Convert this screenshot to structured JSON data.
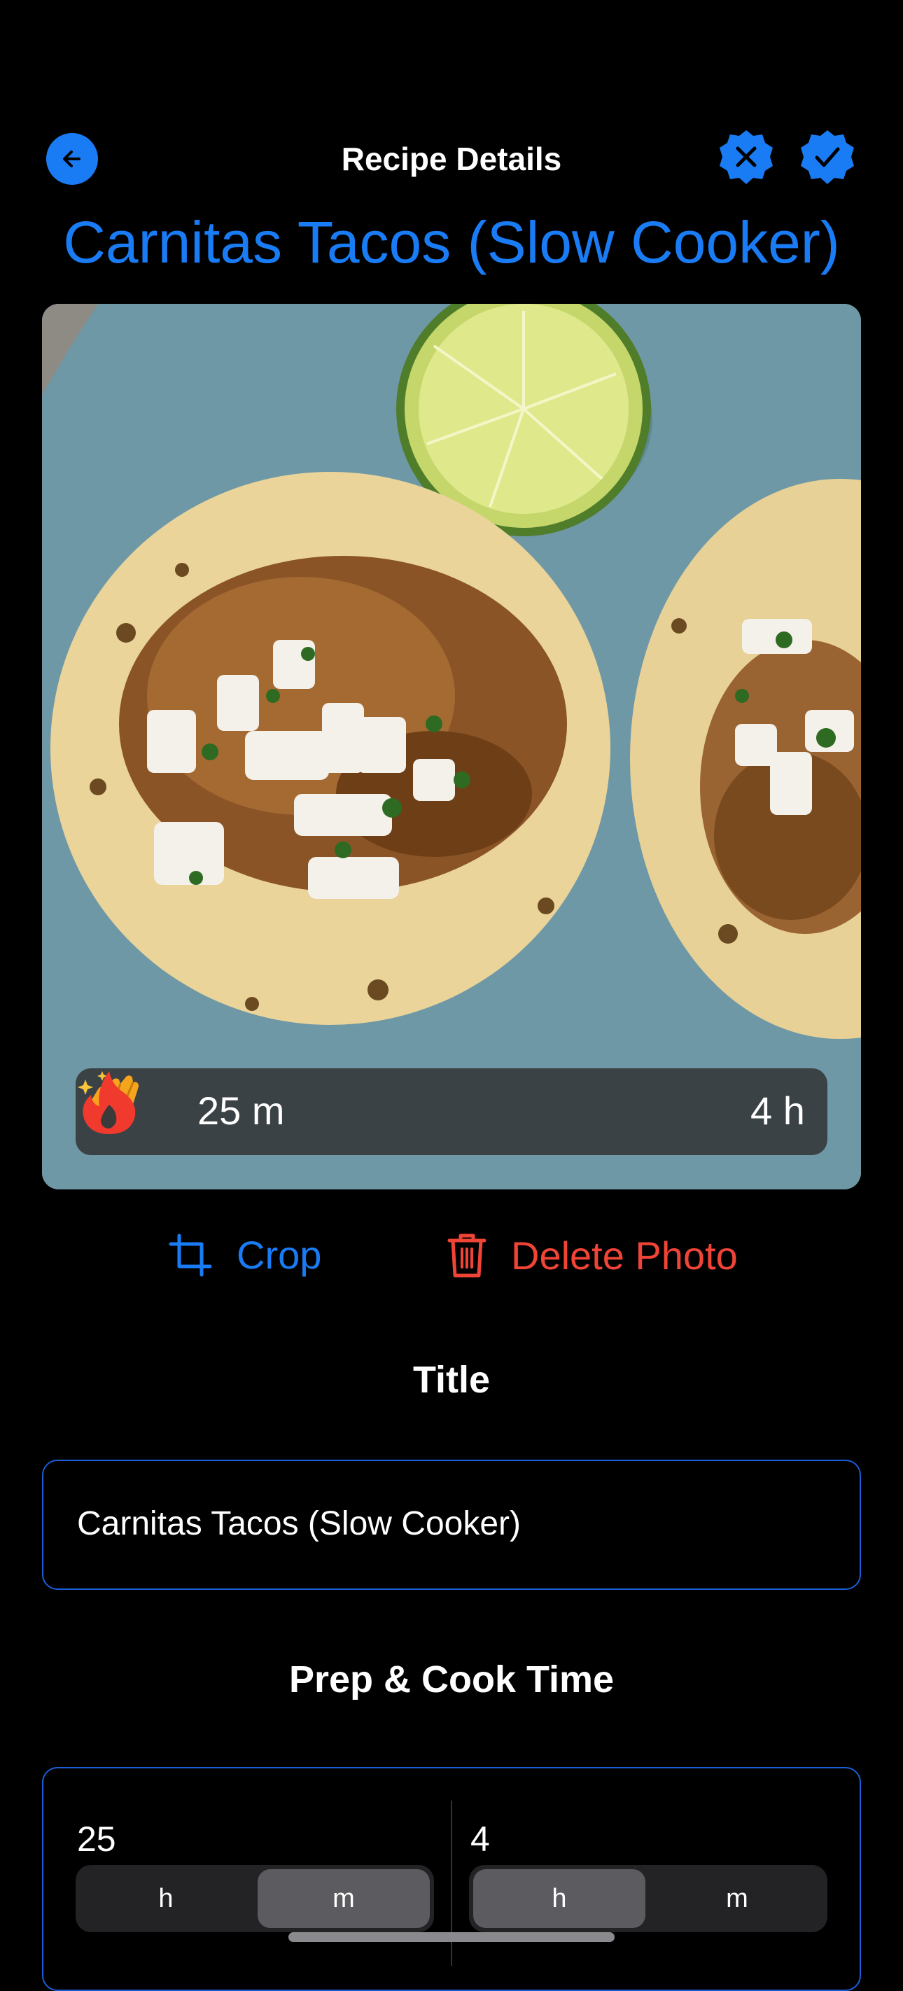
{
  "nav": {
    "title": "Recipe Details"
  },
  "recipe_title": "Carnitas Tacos (Slow Cooker)",
  "photo": {
    "prep_time": "25 m",
    "cook_time": "4 h",
    "prep_icon": "clapping-hands-sparkles",
    "cook_icon": "flame"
  },
  "photo_actions": {
    "crop_label": "Crop",
    "delete_label": "Delete Photo"
  },
  "title_section": {
    "heading": "Title",
    "value": "Carnitas Tacos (Slow Cooker)"
  },
  "time_section": {
    "heading": "Prep & Cook Time",
    "prep": {
      "value": "25",
      "units": [
        "h",
        "m"
      ],
      "selected": "m"
    },
    "cook": {
      "value": "4",
      "units": [
        "h",
        "m"
      ],
      "selected": "h"
    }
  },
  "colors": {
    "accent": "#1a7cf5",
    "danger": "#f04437",
    "flame": "#f03a2e",
    "emoji": "#f7a41d"
  }
}
